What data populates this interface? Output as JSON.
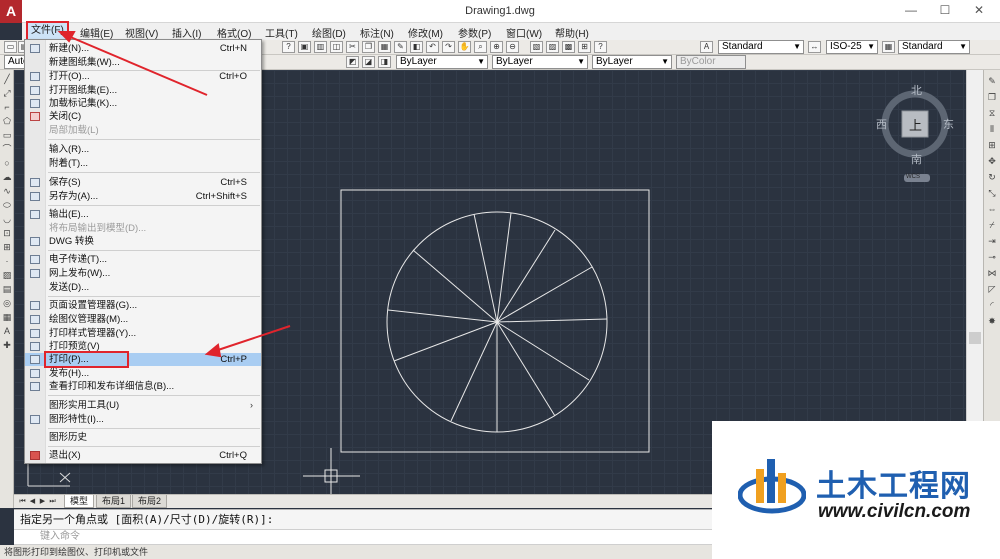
{
  "window": {
    "title": "Drawing1.dwg",
    "logo": "A",
    "controls": [
      "—",
      "☐",
      "✕"
    ]
  },
  "menubar": {
    "items": [
      "文件(F)",
      "编辑(E)",
      "视图(V)",
      "插入(I)",
      "格式(O)",
      "工具(T)",
      "绘图(D)",
      "标注(N)",
      "修改(M)",
      "参数(P)",
      "窗口(W)",
      "帮助(H)"
    ],
    "active": "文件(F)"
  },
  "toolbar": {
    "text_style": "Standard",
    "dim_style": "ISO-25",
    "table_style": "Standard",
    "workspace": "Autodesk",
    "layer": "ByLayer",
    "linetype": "ByLayer",
    "lineweight": "ByLayer",
    "plotstyle": "ByColor"
  },
  "file_menu": {
    "items": [
      {
        "label": "新建(N)...",
        "shortcut": "Ctrl+N",
        "icon": "new-file-icon"
      },
      {
        "label": "新建图纸集(W)...",
        "shortcut": "",
        "icon": ""
      },
      {
        "label": "打开(O)...",
        "shortcut": "Ctrl+O",
        "icon": "open-folder-icon"
      },
      {
        "label": "打开图纸集(E)...",
        "shortcut": "",
        "icon": "open-sheetset-icon"
      },
      {
        "label": "加载标记集(K)...",
        "shortcut": "",
        "icon": "markup-icon"
      },
      {
        "label": "关闭(C)",
        "shortcut": "",
        "icon": "close-file-icon"
      },
      {
        "label": "局部加载(L)",
        "shortcut": "",
        "icon": "",
        "disabled": true
      },
      {
        "label": "输入(R)...",
        "shortcut": "",
        "icon": ""
      },
      {
        "label": "附着(T)...",
        "shortcut": "",
        "icon": ""
      },
      {
        "label": "保存(S)",
        "shortcut": "Ctrl+S",
        "icon": "save-icon"
      },
      {
        "label": "另存为(A)...",
        "shortcut": "Ctrl+Shift+S",
        "icon": "save-as-icon"
      },
      {
        "label": "输出(E)...",
        "shortcut": "",
        "icon": "export-icon"
      },
      {
        "label": "将布局输出到模型(D)...",
        "shortcut": "",
        "icon": "",
        "disabled": true
      },
      {
        "label": "DWG 转换",
        "shortcut": "",
        "icon": "dwg-convert-icon"
      },
      {
        "label": "电子传递(T)...",
        "shortcut": "",
        "icon": "etransmit-icon"
      },
      {
        "label": "网上发布(W)...",
        "shortcut": "",
        "icon": "web-publish-icon"
      },
      {
        "label": "发送(D)...",
        "shortcut": "",
        "icon": ""
      },
      {
        "label": "页面设置管理器(G)...",
        "shortcut": "",
        "icon": "page-setup-icon"
      },
      {
        "label": "绘图仪管理器(M)...",
        "shortcut": "",
        "icon": "plotter-manager-icon"
      },
      {
        "label": "打印样式管理器(Y)...",
        "shortcut": "",
        "icon": "plot-style-icon"
      },
      {
        "label": "打印预览(V)",
        "shortcut": "",
        "icon": "plot-preview-icon"
      },
      {
        "label": "打印(P)...",
        "shortcut": "Ctrl+P",
        "icon": "printer-icon",
        "highlight": true
      },
      {
        "label": "发布(H)...",
        "shortcut": "",
        "icon": "publish-icon"
      },
      {
        "label": "查看打印和发布详细信息(B)...",
        "shortcut": "",
        "icon": "plot-details-icon"
      },
      {
        "label": "图形实用工具(U)",
        "shortcut": "",
        "icon": "",
        "submenu": true
      },
      {
        "label": "图形特性(I)...",
        "shortcut": "",
        "icon": "drawing-properties-icon"
      },
      {
        "label": "图形历史",
        "shortcut": "",
        "icon": ""
      },
      {
        "label": "退出(X)",
        "shortcut": "Ctrl+Q",
        "icon": "exit-icon"
      }
    ]
  },
  "viewcube": {
    "north": "北",
    "south": "南",
    "east": "东",
    "west": "西",
    "face": "上",
    "wcs": "WCS"
  },
  "layout_tabs": [
    "模型",
    "布局1",
    "布局2"
  ],
  "command": {
    "prompt": "指定另一个角点或 [面积(A)/尺寸(D)/旋转(R)]:",
    "input_placeholder": "键入命令"
  },
  "status": "将图形打印到绘图仪、打印机或文件",
  "watermark": {
    "title": "土木工程网",
    "url": "www.civilcn.com"
  },
  "colors": {
    "canvas": "#2b3340",
    "highlight": "#a9cdf2",
    "annotation_red": "#e0242c",
    "brand_blue": "#1f5fb0"
  }
}
